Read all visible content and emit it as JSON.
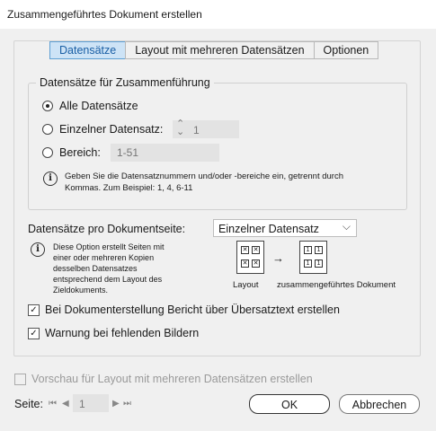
{
  "window": {
    "title": "Zusammengeführtes Dokument erstellen"
  },
  "tabs": [
    {
      "label": "Datensätze",
      "active": true
    },
    {
      "label": "Layout mit mehreren Datensätzen",
      "active": false
    },
    {
      "label": "Optionen",
      "active": false
    }
  ],
  "records_group": {
    "legend": "Datensätze für Zusammenführung",
    "all_records": {
      "label": "Alle Datensätze",
      "selected": true
    },
    "single_record": {
      "label": "Einzelner Datensatz:",
      "value": "1",
      "selected": false
    },
    "range": {
      "label": "Bereich:",
      "placeholder": "1-51",
      "selected": false
    },
    "info_line1": "Geben Sie die Datensatznummern und/oder -bereiche ein, getrennt durch",
    "info_line2": "Kommas. Zum Beispiel: 1, 4, 6-11"
  },
  "records_per_page": {
    "label": "Datensätze pro Dokumentseite:",
    "selected_option": "Einzelner Datensatz",
    "info_lines": [
      "Diese Option erstellt Seiten mit",
      "einer oder mehreren Kopien",
      "desselben Datensatzes",
      "entsprechend dem Layout des",
      "Zieldokuments."
    ],
    "diagram": {
      "left_label": "Layout",
      "right_label": "zusammengeführtes Dokument",
      "arrow": "→",
      "cell_number": "1"
    }
  },
  "options": {
    "overset_report": {
      "label": "Bei Dokumenterstellung Bericht über Übersatztext erstellen",
      "checked": true
    },
    "missing_images": {
      "label": "Warnung bei fehlenden Bildern",
      "checked": true
    }
  },
  "preview": {
    "label": "Vorschau für Layout mit mehreren Datensätzen erstellen",
    "checked": false,
    "enabled": false
  },
  "page_nav": {
    "label": "Seite:",
    "value": "1"
  },
  "buttons": {
    "ok": "OK",
    "cancel": "Abbrechen"
  },
  "glyphs": {
    "check": "✓",
    "info": "i",
    "first": "⏮",
    "prev": "◀",
    "next": "▶",
    "last": "⏭",
    "chevron": "⌵",
    "spin_up": "⌃",
    "spin_down": "⌄"
  }
}
